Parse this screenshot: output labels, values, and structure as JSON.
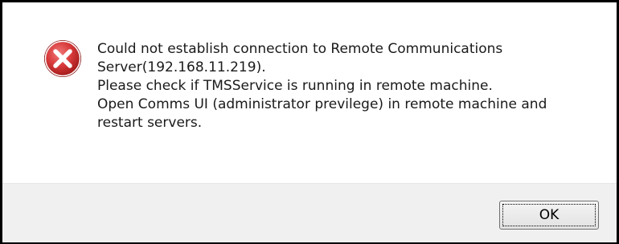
{
  "dialog": {
    "icon": "error-icon",
    "message_lines": [
      "Could not establish connection to Remote Communications",
      "Server(192.168.11.219).",
      "Please check if TMSService is running in remote machine.",
      "Open Comms UI (administrator previlege) in remote machine and",
      "restart servers."
    ],
    "ok_label": "OK"
  },
  "colors": {
    "icon_red": "#c42b2b",
    "footer_bg": "#f0f0f0",
    "border": "#000000"
  }
}
